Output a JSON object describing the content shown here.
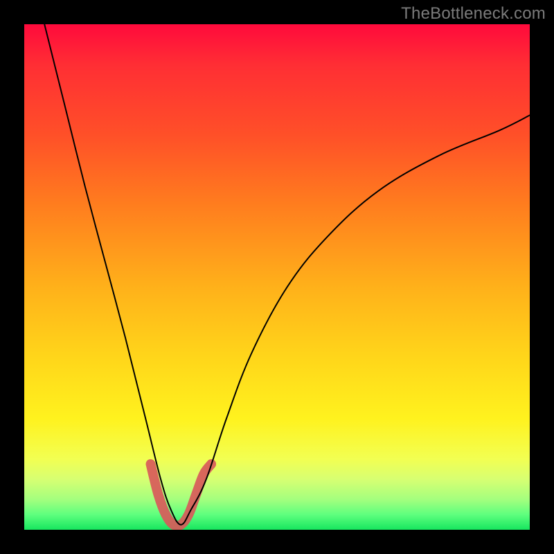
{
  "watermark": "TheBottleneck.com",
  "chart_data": {
    "type": "line",
    "title": "",
    "xlabel": "",
    "ylabel": "",
    "xlim": [
      0,
      100
    ],
    "ylim": [
      0,
      100
    ],
    "grid": false,
    "legend": false,
    "series": [
      {
        "name": "bottleneck-curve",
        "x": [
          4,
          8,
          12,
          16,
          20,
          24,
          27,
          29,
          31,
          33,
          36,
          40,
          45,
          52,
          60,
          70,
          82,
          94,
          100
        ],
        "values": [
          100,
          84,
          68,
          53,
          38,
          22,
          10,
          4,
          1,
          4,
          10,
          22,
          35,
          48,
          58,
          67,
          74,
          79,
          82
        ]
      },
      {
        "name": "tolerance-window",
        "x": [
          25,
          26.5,
          28,
          29.5,
          31,
          32.5,
          34,
          35.5,
          37
        ],
        "values": [
          13,
          7,
          3,
          1,
          1,
          3,
          7,
          11,
          13
        ]
      }
    ],
    "colors": {
      "curve": "#000000",
      "accent": "#d85a5a",
      "gradient_top": "#ff0a3c",
      "gradient_mid": "#ffd61a",
      "gradient_bottom": "#17e65f",
      "frame": "#000000"
    }
  }
}
